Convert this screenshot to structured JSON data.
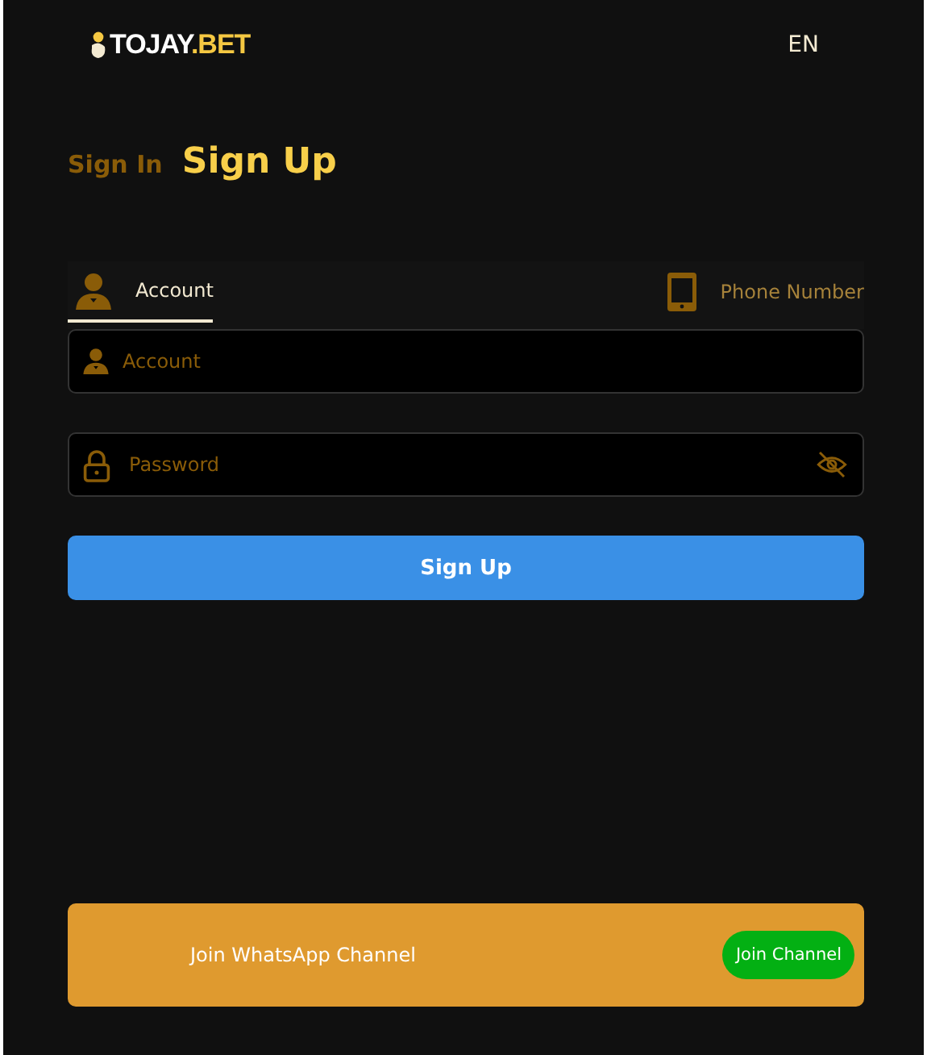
{
  "header": {
    "logo": {
      "name": "TOJAY",
      "suffix": ".BET"
    },
    "language": "EN"
  },
  "auth_tabs": [
    {
      "label": "Sign In",
      "selected": false
    },
    {
      "label": "Sign Up",
      "selected": true
    }
  ],
  "method_tabs": [
    {
      "label": "Account",
      "kind": "account",
      "selected": true
    },
    {
      "label": "Phone Number",
      "kind": "phone",
      "selected": false
    }
  ],
  "fields": [
    {
      "kind": "account",
      "placeholder": "Account"
    },
    {
      "kind": "password",
      "placeholder": "Password"
    }
  ],
  "submit": "Sign Up",
  "banner": {
    "text": "Join WhatsApp Channel",
    "button": "Join Channel"
  }
}
